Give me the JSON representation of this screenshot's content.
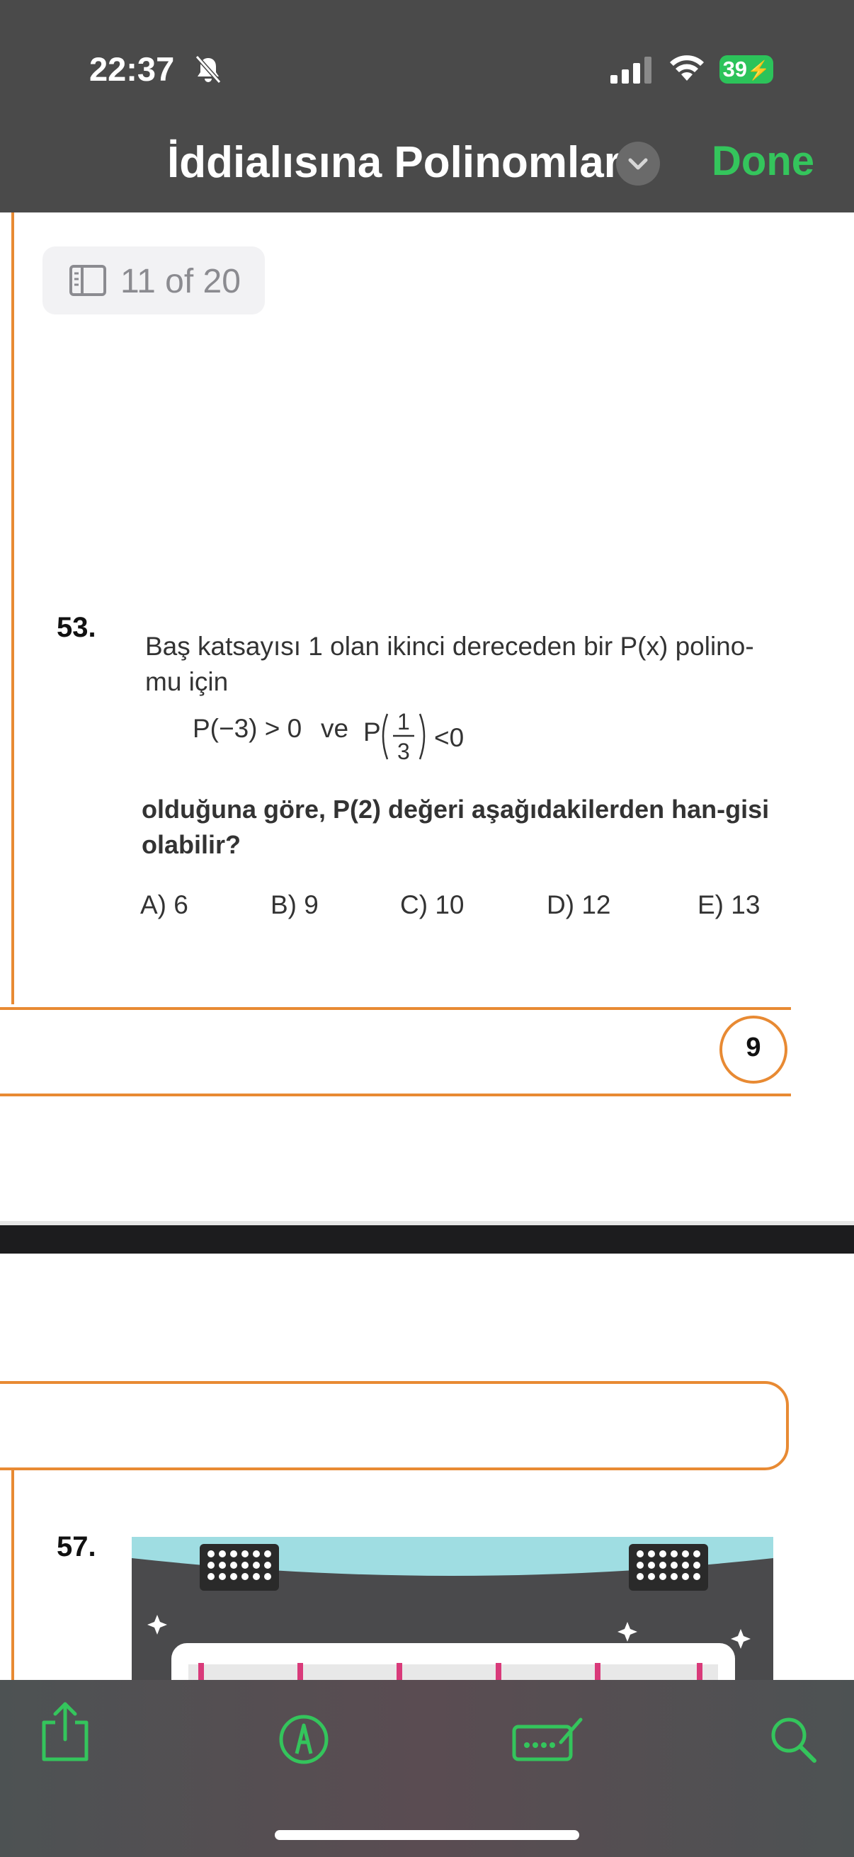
{
  "status_bar": {
    "time": "22:37",
    "battery": "39",
    "icons": [
      "bell-slash-icon",
      "cellular-signal-icon",
      "wifi-icon",
      "battery-charging-icon"
    ]
  },
  "header": {
    "title": "İddialısına Polinomlar",
    "done_label": "Done"
  },
  "page_indicator": {
    "text": "11 of 20"
  },
  "question_53": {
    "number": "53.",
    "text": "Baş katsayısı 1 olan ikinci dereceden bir P(x) polino-mu için",
    "condition_left": "P(−3) > 0",
    "condition_connector": "ve",
    "condition_right_prefix": "P",
    "fraction_numerator": "1",
    "fraction_denominator": "3",
    "condition_right_suffix": "<0",
    "bold_text": "olduğuna göre, P(2) değeri aşağıdakilerden han-gisi olabilir?",
    "choices": [
      "A) 6",
      "B) 9",
      "C) 10",
      "D) 12",
      "E) 13"
    ]
  },
  "page_number": "9",
  "question_57": {
    "number": "57."
  },
  "toolbar": {
    "icons": [
      "share-icon",
      "markup-icon",
      "signature-icon",
      "search-icon"
    ]
  },
  "colors": {
    "accent_orange": "#e88a33",
    "done_green": "#34c55c",
    "bar_gray": "#4a4a4a"
  }
}
